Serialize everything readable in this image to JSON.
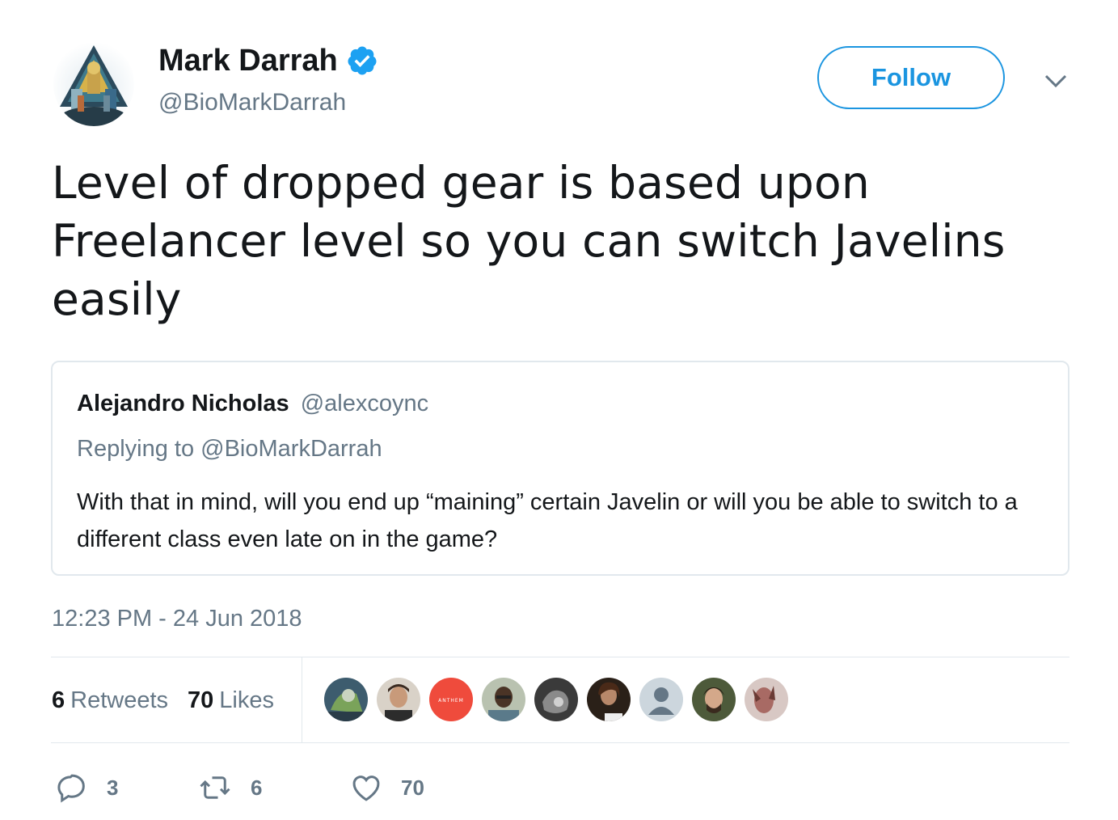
{
  "author": {
    "display_name": "Mark Darrah",
    "handle": "@BioMarkDarrah",
    "verified_icon": "verified-badge-icon",
    "avatar_icon": "anthem-avatar"
  },
  "follow_label": "Follow",
  "tweet_text": "Level of dropped gear is based upon Freelancer level so you can switch Javelins easily",
  "quoted": {
    "name": "Alejandro Nicholas",
    "handle": "@alexcoync",
    "replying_to": "Replying to @BioMarkDarrah",
    "text": "With that in mind, will you end up “maining” certain Javelin or will you be able to switch to a different class even late on in the game?"
  },
  "timestamp": "12:23 PM - 24 Jun 2018",
  "stats": {
    "retweets_count": "6",
    "retweets_label": "Retweets",
    "likes_count": "70",
    "likes_label": "Likes"
  },
  "likers": [
    {
      "icon": "liker-avatar-1",
      "color": "#4a6b52"
    },
    {
      "icon": "liker-avatar-2",
      "color": "#7a5a44"
    },
    {
      "icon": "liker-avatar-anthem",
      "color": "#ef4b3c",
      "text": "ANTHEM"
    },
    {
      "icon": "liker-avatar-4",
      "color": "#8a8f7a"
    },
    {
      "icon": "liker-avatar-5",
      "color": "#5a5a5a"
    },
    {
      "icon": "liker-avatar-6",
      "color": "#3a3026"
    },
    {
      "icon": "liker-avatar-default",
      "color": "#ccd6dd"
    },
    {
      "icon": "liker-avatar-8",
      "color": "#4d5a3a"
    },
    {
      "icon": "liker-avatar-9",
      "color": "#a88078"
    }
  ],
  "actions": {
    "reply_count": "3",
    "retweet_count": "6",
    "like_count": "70"
  },
  "colors": {
    "accent": "#1b95e0",
    "text": "#14171a",
    "secondary": "#657786",
    "border": "#e1e8ed"
  }
}
